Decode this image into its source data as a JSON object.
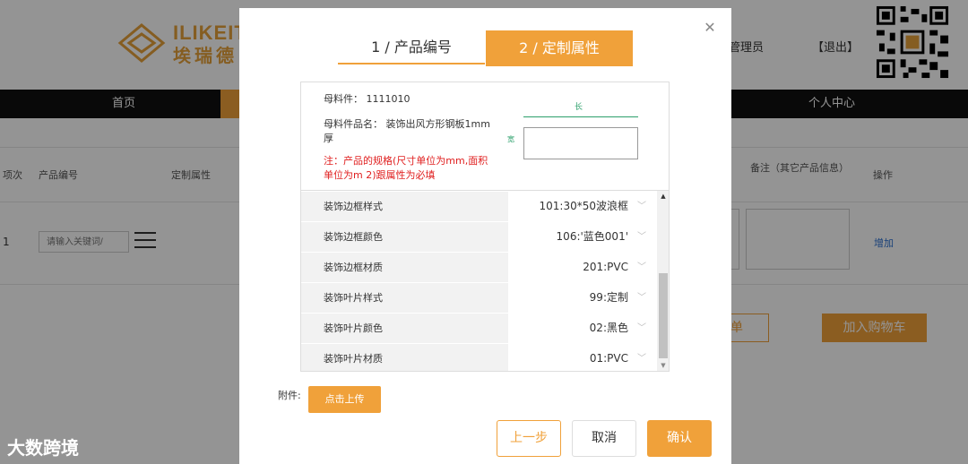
{
  "header": {
    "logo_en": "ILIKEIT",
    "logo_cn": "埃瑞德",
    "user_label": "管理员",
    "logout_label": "【退出】"
  },
  "nav": {
    "items": [
      "首页",
      "个人中心"
    ]
  },
  "table": {
    "headers": [
      "项次",
      "产品编号",
      "定制属性",
      "备注（其它产品信息）",
      "操作"
    ],
    "row_index": "1",
    "keyword_placeholder": "请输入关键词/",
    "add_link": "增加"
  },
  "page_buttons": {
    "partial_outline": "单",
    "add_to_cart": "加入购物车"
  },
  "watermark": "大数跨境",
  "modal": {
    "tabs": [
      "1 / 产品编号",
      "2 / 定制属性"
    ],
    "active_tab": 1,
    "close_icon": "close-icon",
    "info": {
      "parent_part": "母料件： 1111010",
      "parent_name_line1": "母料件品名： 装饰出风方形钢板1mm",
      "parent_name_line2": "厚",
      "note_line1": "注：产品的规格(尺寸单位为mm,面积",
      "note_line2": "单位为m 2)跟属性为必填",
      "dim_top": "长",
      "dim_side": "宽"
    },
    "attributes": [
      {
        "label": "装饰边框样式",
        "value": "101:30*50波浪框"
      },
      {
        "label": "装饰边框颜色",
        "value": "106:'蓝色001'"
      },
      {
        "label": "装饰边框材质",
        "value": "201:PVC"
      },
      {
        "label": "装饰叶片样式",
        "value": "99:定制"
      },
      {
        "label": "装饰叶片颜色",
        "value": "02:黑色"
      },
      {
        "label": "装饰叶片材质",
        "value": "01:PVC"
      }
    ],
    "attachment_label": "附件:",
    "upload_label": "点击上传",
    "buttons": {
      "prev": "上一步",
      "cancel": "取消",
      "confirm": "确认"
    }
  },
  "colors": {
    "accent": "#f0a13a",
    "nav_bg": "#111111",
    "note_red": "#e02020"
  }
}
